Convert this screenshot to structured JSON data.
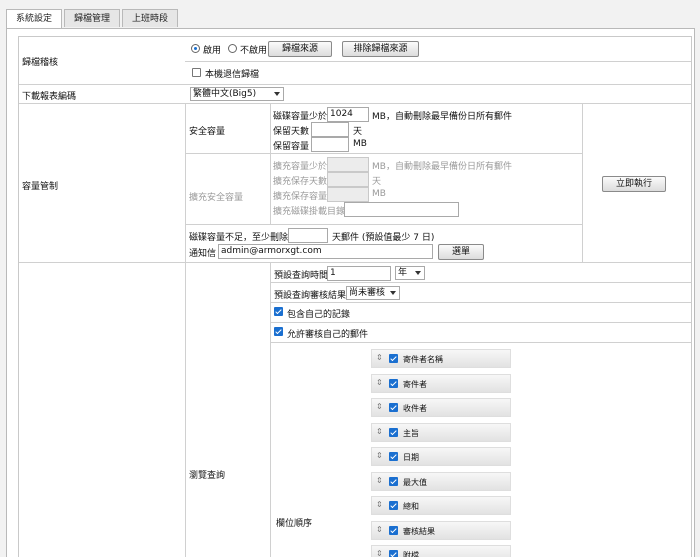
{
  "tabs": [
    {
      "label": "系統設定",
      "active": true
    },
    {
      "label": "歸檔管理",
      "active": false
    },
    {
      "label": "上班時段",
      "active": false
    }
  ],
  "archive": {
    "label": "歸檔稽核",
    "enable_label": "啟用",
    "disable_label": "不啟用",
    "selected": "enable",
    "source_button": "歸檔來源",
    "exclude_button": "排除歸檔來源",
    "bounce_label": "本機退信歸檔",
    "bounce_checked": false
  },
  "report_encoding": {
    "label": "下載報表編碼",
    "value": "繁體中文(Big5)"
  },
  "capacity": {
    "label": "容量管制",
    "safe_label": "安全容量",
    "disk_less_than": "磁碟容量少於",
    "disk_value": "1024",
    "disk_suffix": "MB，自動刪除最早備份日所有郵件",
    "keep_days": "保留天數",
    "days_unit": "天",
    "keep_size": "保留容量",
    "mb_unit": "MB",
    "ext_label": "擴充安全容量",
    "ext_less_than": "擴充容量少於",
    "ext_suffix": "MB，自動刪除最早備份日所有郵件",
    "ext_keep_days": "擴充保存天數",
    "ext_keep_size": "擴充保存容量",
    "ext_mount": "擴充磁碟掛載目錄",
    "insufficient": "磁碟容量不足，至少刪除",
    "insufficient_suffix": "天郵件 (預設值最少 7 日)",
    "notify_label": "通知信",
    "notify_value": "admin@armorxgt.com",
    "pick_button": "選單",
    "run_button": "立即執行"
  },
  "browse": {
    "label": "瀏覽查詢",
    "default_time_label": "預設查詢時間",
    "default_time_value": "1",
    "time_unit": "年",
    "default_result_label": "預設查詢審核結果",
    "default_result_value": "尚未審核",
    "include_own_label": "包含自己的記錄",
    "include_own_checked": true,
    "allow_own_label": "允許審核自己的郵件",
    "allow_own_checked": true,
    "field_order_label": "欄位順序",
    "handle_glyph": "⇕",
    "fields": [
      "寄件者名稱",
      "寄件者",
      "收件者",
      "主旨",
      "日期",
      "最大值",
      "總和",
      "審核結果",
      "附檔"
    ]
  }
}
